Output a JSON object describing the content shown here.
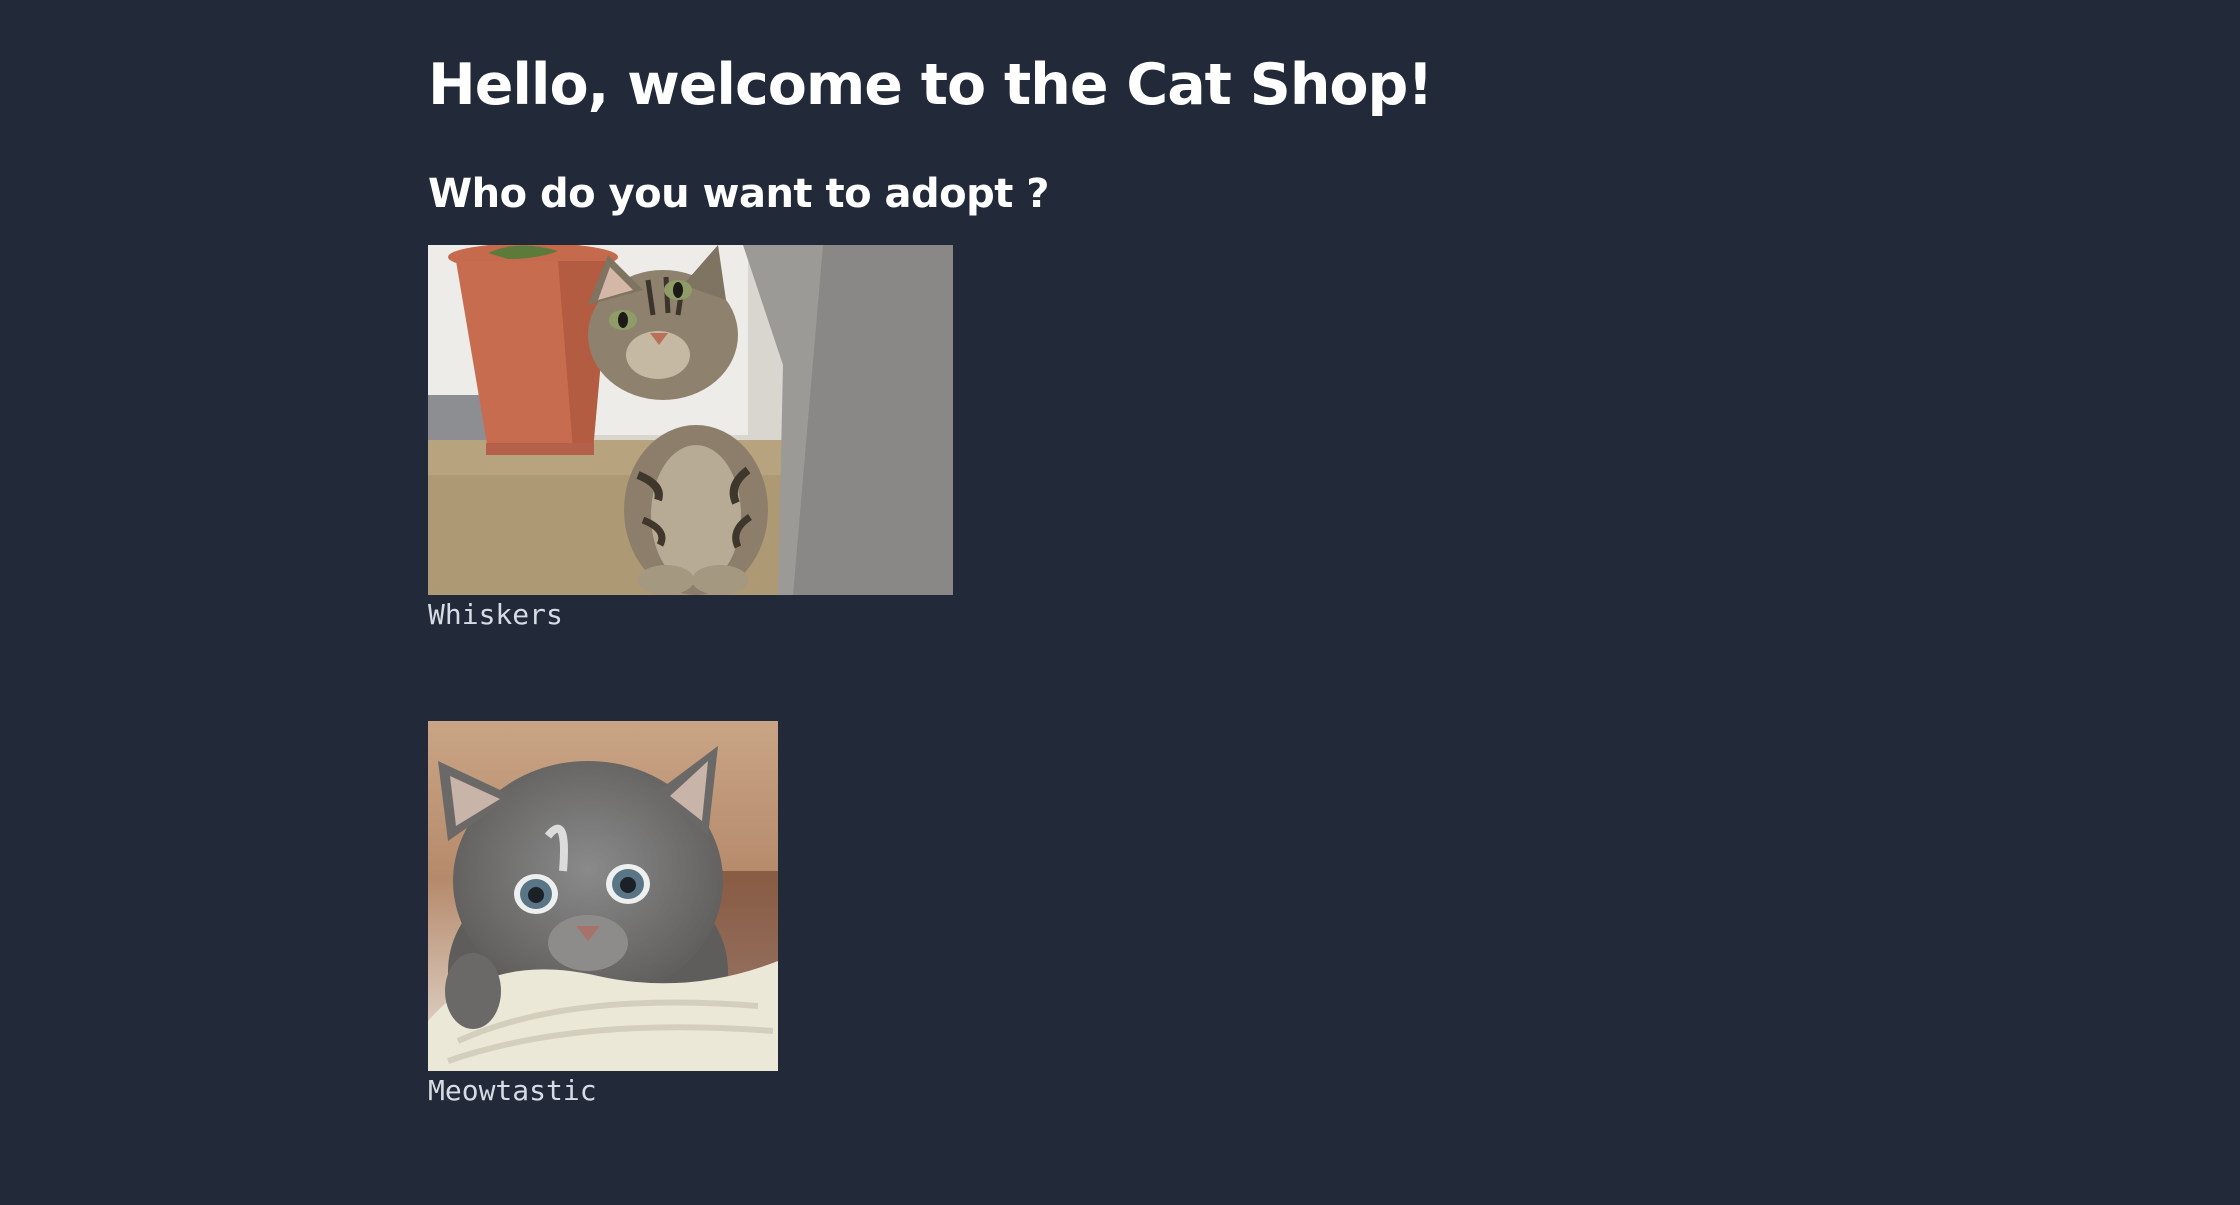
{
  "header": {
    "title": "Hello, welcome to the Cat Shop!",
    "subtitle": "Who do you want to adopt ?"
  },
  "cats": [
    {
      "name": "Whiskers"
    },
    {
      "name": "Meowtastic"
    }
  ],
  "colors": {
    "background": "#222a3a",
    "text": "#ffffff",
    "caption": "#d6dbe4"
  }
}
